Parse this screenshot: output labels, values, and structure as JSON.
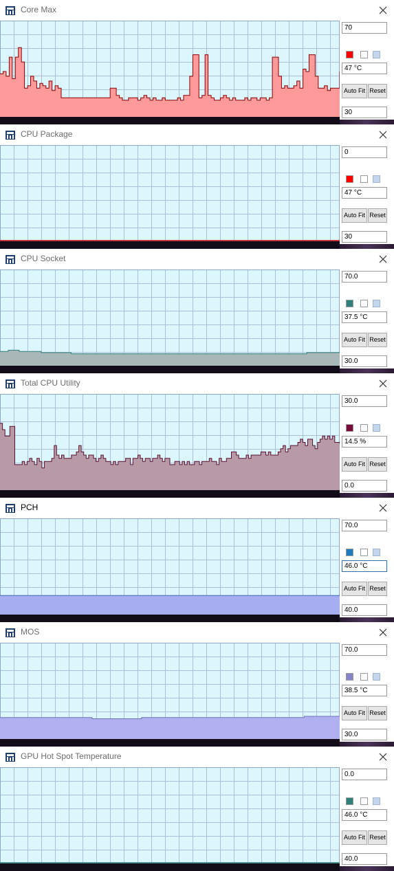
{
  "windows": [
    {
      "title": "Core Max",
      "max": "70",
      "current": "47 °C",
      "min": "30",
      "color": "#ff0000",
      "fill": "#ff9a9a",
      "stroke": "#8b0000",
      "ymin": 30,
      "ymax": 70,
      "active": false,
      "series": [
        48,
        49,
        47,
        55,
        46,
        55,
        59,
        53,
        42,
        43,
        47,
        45,
        42,
        44,
        43,
        42,
        45,
        41,
        43,
        42,
        38,
        38,
        38,
        38,
        38,
        38,
        38,
        38,
        38,
        38,
        38,
        38,
        38,
        38,
        38,
        38,
        42,
        42,
        39,
        38,
        37,
        37,
        38,
        38,
        38,
        37,
        38,
        39,
        38,
        37,
        38,
        37,
        37,
        38,
        37,
        37,
        37,
        37,
        38,
        37,
        39,
        39,
        47,
        56,
        56,
        38,
        39,
        56,
        39,
        38,
        37,
        37,
        38,
        39,
        38,
        37,
        38,
        37,
        37,
        37,
        38,
        37,
        38,
        38,
        37,
        38,
        38,
        37,
        38,
        55,
        55,
        47,
        42,
        43,
        42,
        42,
        43,
        45,
        42,
        50,
        49,
        56,
        56,
        47,
        42,
        42,
        43,
        41,
        42,
        42,
        42,
        49
      ]
    },
    {
      "title": "CPU Package",
      "max": "0",
      "current": "47 °C",
      "min": "30",
      "color": "#ff0000",
      "fill": "#ff9a9a",
      "stroke": "#cc0000",
      "ymin": 30,
      "ymax": 0,
      "active": false,
      "series": []
    },
    {
      "title": "CPU Socket",
      "max": "70.0",
      "current": "37.5 °C",
      "min": "30.0",
      "color": "#2f7f7a",
      "fill": "#a8b8b8",
      "stroke": "#2f7f7a",
      "ymin": 30,
      "ymax": 70,
      "active": false,
      "series": [
        36,
        36,
        36,
        36.5,
        36.5,
        36.5,
        36.5,
        36,
        36,
        36,
        36,
        36,
        36,
        36,
        36,
        35.5,
        35.5,
        35.5,
        35.5,
        35.5,
        35.5,
        35.5,
        35.5,
        35.5,
        35.5,
        35.5,
        35,
        35,
        35,
        35,
        35,
        35,
        35,
        35,
        35,
        35,
        35,
        35,
        35,
        35,
        35,
        35,
        35,
        35,
        35,
        35,
        35,
        35,
        35,
        35,
        35,
        35,
        35,
        35,
        35,
        35,
        35,
        35,
        35,
        35,
        35,
        35,
        35,
        35,
        35,
        35,
        35,
        35,
        35,
        35,
        35,
        35,
        35,
        35,
        35,
        35,
        35,
        35,
        35,
        35,
        35,
        35,
        35,
        35,
        35,
        35,
        35,
        35,
        35,
        35,
        35,
        35,
        35,
        35,
        35,
        35,
        35,
        35,
        35,
        35,
        35,
        35,
        35,
        35,
        35,
        35,
        35,
        35,
        35,
        35,
        35,
        35,
        35.5,
        35.5,
        35.5,
        35.5,
        35.5,
        35.5,
        35.5,
        35.5,
        35.5,
        35.5,
        35.5,
        35.5,
        36
      ]
    },
    {
      "title": "Total CPU Utility",
      "max": "30.0",
      "current": "14.5 %",
      "min": "0.0",
      "color": "#7a0a3a",
      "fill": "#b89aa6",
      "stroke": "#5a1030",
      "ymin": 0,
      "ymax": 30,
      "active": false,
      "series": [
        21,
        19,
        17,
        17,
        20,
        20,
        8,
        8,
        8,
        9,
        8,
        9,
        10,
        9,
        8,
        10,
        9,
        7,
        9,
        9,
        9,
        10,
        14,
        11,
        10,
        11,
        10,
        10,
        10,
        11,
        11,
        12,
        14,
        12,
        11,
        10,
        11,
        11,
        10,
        9,
        10,
        11,
        10,
        9,
        9,
        8,
        9,
        8,
        9,
        9,
        9,
        10,
        10,
        8,
        10,
        10,
        11,
        10,
        9,
        10,
        10,
        9,
        10,
        10,
        11,
        10,
        9,
        10,
        10,
        8,
        8,
        9,
        9,
        8,
        9,
        8,
        9,
        8,
        8,
        9,
        9,
        8,
        9,
        9,
        9,
        10,
        9,
        9,
        8,
        10,
        9,
        9,
        10,
        10,
        12,
        12,
        11,
        10,
        10,
        10,
        11,
        10,
        11,
        11,
        11,
        11,
        12,
        12,
        11,
        12,
        11,
        11,
        11,
        12,
        13,
        14,
        12,
        13,
        14,
        14,
        14,
        15,
        16,
        15,
        14,
        16,
        16,
        14,
        13,
        15,
        16,
        17,
        16,
        17,
        16,
        17,
        15,
        15,
        14.5
      ]
    },
    {
      "title": "PCH",
      "max": "70.0",
      "current": "46.0 °C",
      "min": "40.0",
      "color": "#1f7ac0",
      "fill": "#a6aef0",
      "stroke": "#3c6bb0",
      "ymin": 40,
      "ymax": 70,
      "active": true,
      "series": [
        46,
        46,
        46,
        46,
        46,
        46,
        46,
        46,
        46,
        46,
        46,
        46,
        46,
        46,
        46,
        46,
        46,
        46,
        46,
        46
      ]
    },
    {
      "title": "MOS",
      "max": "70.0",
      "current": "38.5 °C",
      "min": "30.0",
      "color": "#8585c8",
      "fill": "#b0b0f0",
      "stroke": "#7070b8",
      "ymin": 30,
      "ymax": 70,
      "active": false,
      "series": [
        39,
        39,
        39,
        39,
        39,
        39,
        39,
        39,
        39,
        39,
        39,
        39,
        39,
        38.5,
        38.5,
        38.5,
        38.5,
        38.5,
        38.5,
        38.5,
        39,
        39,
        39,
        39,
        39,
        39,
        39,
        39,
        39,
        39,
        39,
        39,
        39,
        39,
        39,
        39,
        39,
        39,
        39,
        39,
        39,
        39,
        39,
        39.5,
        39.5,
        39.5,
        39.5,
        39.5,
        39.5
      ]
    },
    {
      "title": "GPU Hot Spot Temperature",
      "max": "0.0",
      "current": "46.0 °C",
      "min": "40.0",
      "color": "#2f7f7a",
      "fill": "#a8b8b8",
      "stroke": "#2f7f7a",
      "ymin": 40,
      "ymax": 0,
      "active": false,
      "series": []
    }
  ],
  "labels": {
    "autofit": "Auto Fit",
    "reset": "Reset"
  }
}
